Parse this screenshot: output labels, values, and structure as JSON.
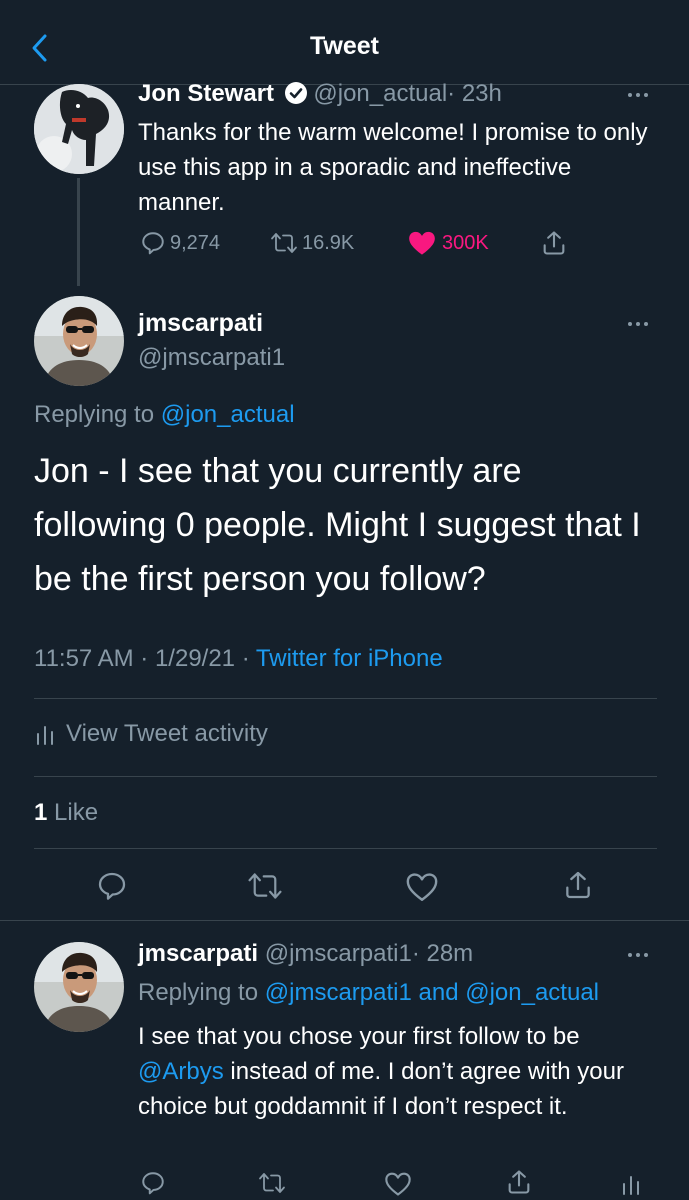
{
  "header": {
    "title": "Tweet"
  },
  "parent_tweet": {
    "name": "Jon Stewart",
    "handle": "@jon_actual",
    "time": "· 23h",
    "text": "Thanks for the warm welcome! I promise to only use this app in a sporadic and ineffective manner.",
    "replies": "9,274",
    "retweets": "16.9K",
    "likes": "300K"
  },
  "main_tweet": {
    "name": "jmscarpati",
    "handle": "@jmscarpati1",
    "replying_prefix": "Replying to ",
    "replying_to": "@jon_actual",
    "text": "Jon - I see that you currently are following 0 people. Might I suggest that I be the first person you follow?",
    "timestamp": "11:57 AM · 1/29/21 · ",
    "source": "Twitter for iPhone",
    "activity_label": "View Tweet activity",
    "like_count": "1",
    "like_label": " Like"
  },
  "reply_tweet": {
    "name": "jmscarpati",
    "handle": "@jmscarpati1",
    "time": "· 28m",
    "replying_prefix": "Replying to ",
    "replying_to_1": "@jmscarpati1",
    "replying_and": " and ",
    "replying_to_2": "@jon_actual",
    "text_mention": "@Arbys",
    "text_1": "I see that you chose your first follow to be ",
    "text_2": " instead of me. I don’t agree with your choice but goddamnit if I don’t respect it."
  },
  "colors": {
    "background": "#15202b",
    "accent": "#1d9bf0",
    "like": "#f91880",
    "muted": "#8899a6"
  }
}
